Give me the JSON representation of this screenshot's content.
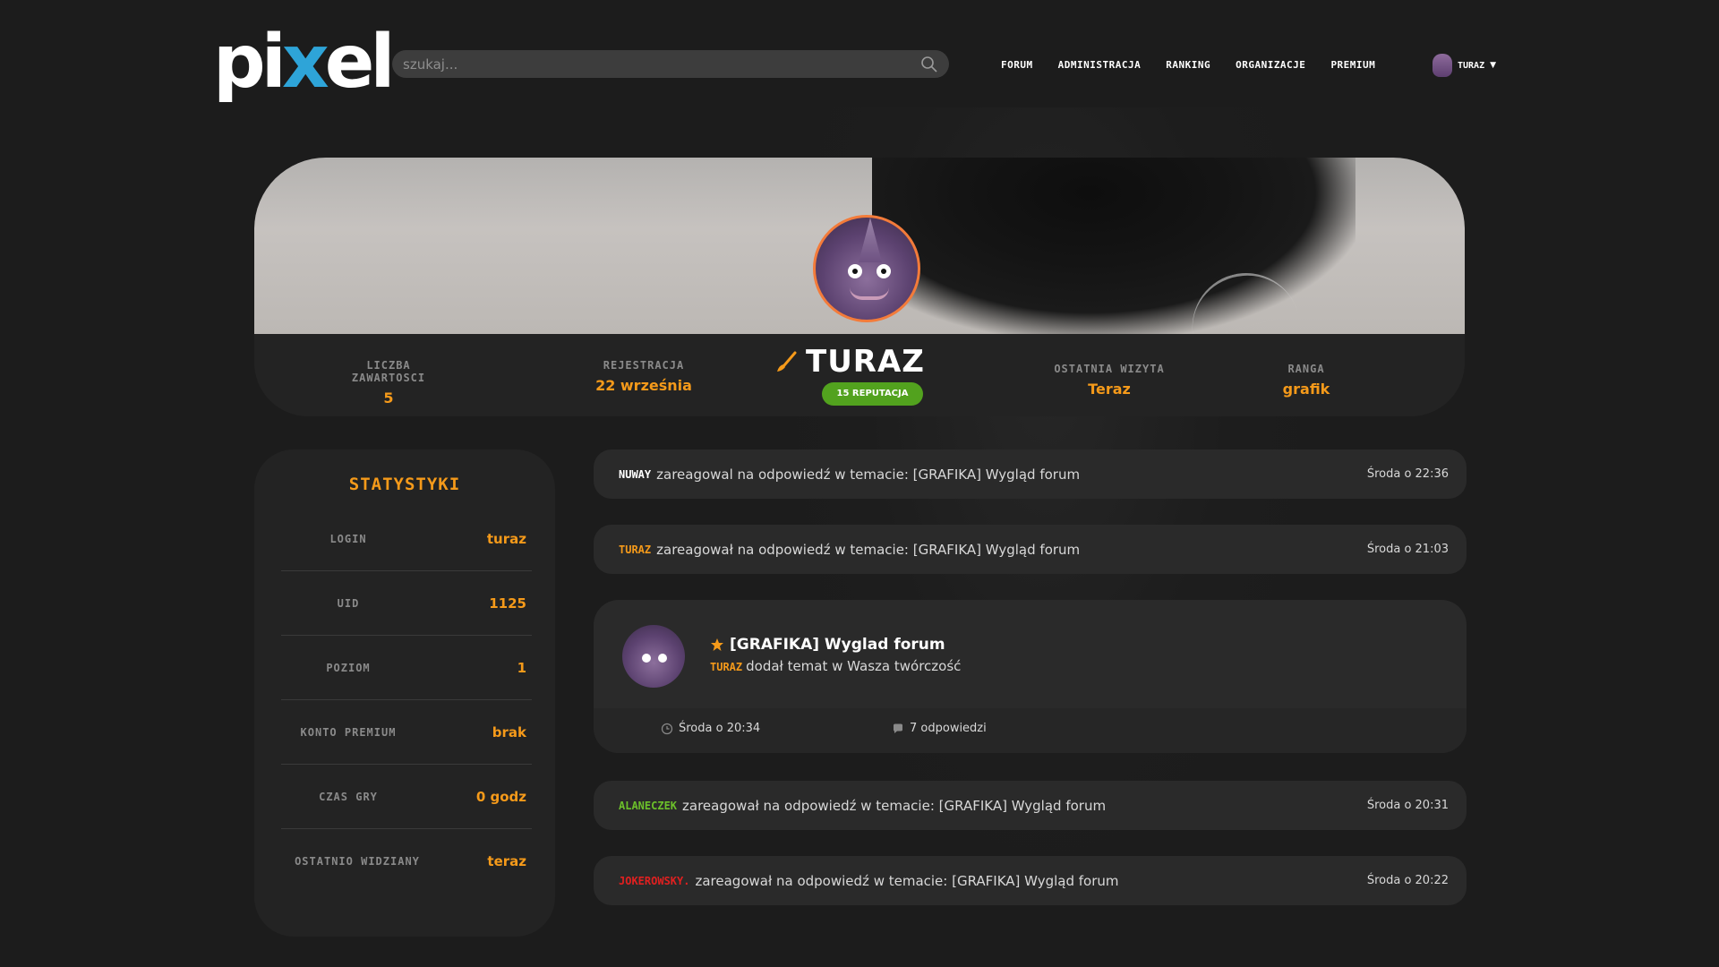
{
  "header": {
    "logo_text_a": "pi",
    "logo_text_x": "x",
    "logo_text_b": "el",
    "search_placeholder": "szukaj...",
    "nav": [
      "FORUM",
      "ADMINISTRACJA",
      "RANKING",
      "ORGANIZACJE",
      "PREMIUM"
    ],
    "user": {
      "name": "TURAZ"
    }
  },
  "profile": {
    "username": "TURAZ",
    "reputation": "15 REPUTACJA",
    "stats": [
      {
        "label": "LICZBA ZAWARTOSCI",
        "value": "5"
      },
      {
        "label": "REJESTRACJA",
        "value": "22 września"
      },
      {
        "label": "OSTATNIA WIZYTA",
        "value": "Teraz"
      },
      {
        "label": "RANGA",
        "value": "grafik"
      }
    ]
  },
  "sidebar": {
    "title": "STATYSTYKI",
    "rows": [
      {
        "key": "LOGIN",
        "value": "turaz"
      },
      {
        "key": "UID",
        "value": "1125"
      },
      {
        "key": "POZIOM",
        "value": "1"
      },
      {
        "key": "KONTO PREMIUM",
        "value": "brak"
      },
      {
        "key": "CZAS GRY",
        "value": "0 godz"
      },
      {
        "key": "OSTATNIO WIDZIANY",
        "value": "teraz"
      }
    ]
  },
  "activity": [
    {
      "who": "NUWAY",
      "who_color": "#ffffff",
      "text": "zareagowal na odpowiedź w temacie: [GRAFIKA] Wygląd forum",
      "time": "Środa o 22:36"
    },
    {
      "who": "TURAZ",
      "who_color": "#f59a1a",
      "text": "zareagował na odpowiedź w temacie: [GRAFIKA] Wygląd forum",
      "time": "Środa o 21:03"
    },
    {
      "who": "ALANECZEK",
      "who_color": "#6cc02a",
      "text": "zareagował na odpowiedź w temacie: [GRAFIKA] Wygląd forum",
      "time": "Środa o 20:31"
    },
    {
      "who": "JOKEROWSKY.",
      "who_color": "#e02020",
      "text": "zareagował na odpowiedź w temacie: [GRAFIKA] Wygląd forum",
      "time": "Środa o 20:22"
    }
  ],
  "topic": {
    "title": "[GRAFIKA] Wyglad forum",
    "author": "TURAZ",
    "subtitle": "dodał temat w Wasza twórczość",
    "time": "Środa o 20:34",
    "replies": "7 odpowiedzi"
  },
  "colors": {
    "accent": "#f59a1a",
    "badge": "#52a21e",
    "logo_x": "#2ea4d8"
  }
}
